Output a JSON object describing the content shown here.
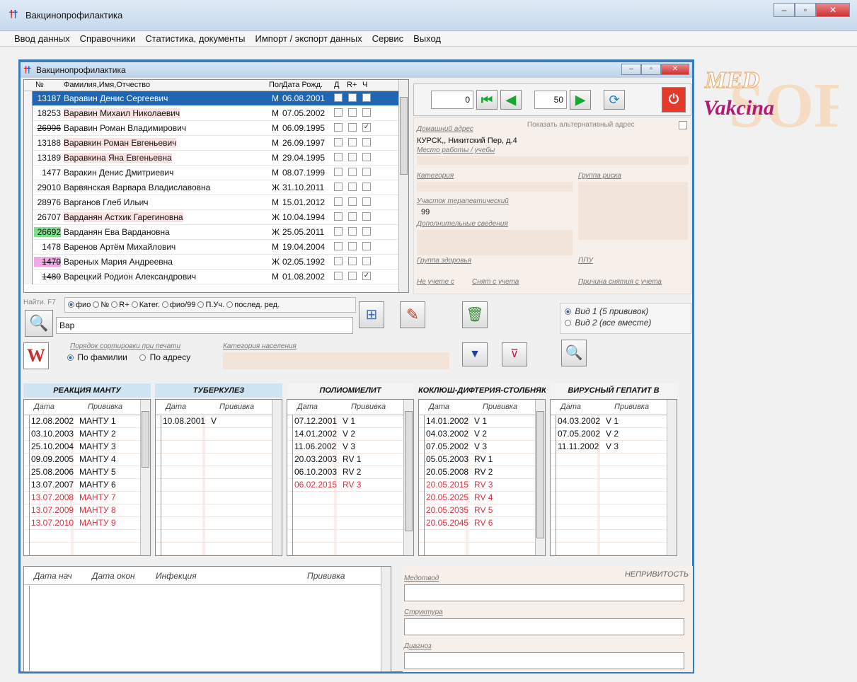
{
  "app": {
    "title": "Вакцинопрофилактика",
    "child_title": "Вакцинопрофилактика",
    "logo_top": "MED",
    "logo_bottom": "Vakcina",
    "logo_bg": "SOFT"
  },
  "menu": [
    "Ввод данных",
    "Справочники",
    "Статистика, документы",
    "Импорт / экспорт данных",
    "Сервис",
    "Выход"
  ],
  "grid": {
    "headers": {
      "num": "№",
      "fio": "Фамилия,Имя,Отчество",
      "sex": "Пол",
      "dob": "Дата Рожд.",
      "d": "Д",
      "r": "R+",
      "ch": "Ч"
    },
    "rows": [
      {
        "num": "13187",
        "fio": "Варавин Денис Сергеевич",
        "sex": "М",
        "dob": "06.08.2001",
        "checked": false
      },
      {
        "num": "18253",
        "fio": "Варавин Михаил Николаевич",
        "sex": "М",
        "dob": "07.05.2002",
        "checked": false
      },
      {
        "num": "26996",
        "fio": "Варавин Роман Владимирович",
        "sex": "М",
        "dob": "06.09.1995",
        "checked": true
      },
      {
        "num": "13188",
        "fio": "Варавкин Роман Евгеньевич",
        "sex": "М",
        "dob": "26.09.1997",
        "checked": false
      },
      {
        "num": "13189",
        "fio": "Варавкина Яна Евгеньевна",
        "sex": "М",
        "dob": "29.04.1995",
        "checked": false
      },
      {
        "num": "1477",
        "fio": "Варакин Денис Дмитриевич",
        "sex": "М",
        "dob": "08.07.1999",
        "checked": false
      },
      {
        "num": "29010",
        "fio": "Варвянская Варвара Владиславовна",
        "sex": "Ж",
        "dob": "31.10.2011",
        "checked": false
      },
      {
        "num": "28976",
        "fio": "Варганов Глеб Ильич",
        "sex": "М",
        "dob": "15.01.2012",
        "checked": false
      },
      {
        "num": "26707",
        "fio": "Варданян Астхик Гарегиновна",
        "sex": "Ж",
        "dob": "10.04.1994",
        "checked": false
      },
      {
        "num": "26692",
        "fio": "Варданян Ева Вардановна",
        "sex": "Ж",
        "dob": "25.05.2011",
        "checked": false
      },
      {
        "num": "1478",
        "fio": "Варенов Артём Михайлович",
        "sex": "М",
        "dob": "19.04.2004",
        "checked": false
      },
      {
        "num": "1479",
        "fio": "Вареных Мария Андреевна",
        "sex": "Ж",
        "dob": "02.05.1992",
        "checked": false
      },
      {
        "num": "1480",
        "fio": "Варецкий Родион Александрович",
        "sex": "М",
        "dob": "01.08.2002",
        "checked": true
      }
    ]
  },
  "nav": {
    "from": "0",
    "to": "50"
  },
  "detail": {
    "home_address_label": "Домашний адрес",
    "alt_address_label": "Показать альтернативный адрес",
    "address": "КУРСК,, Никитский Пер, д.4",
    "work_label": "Место работы / учебы",
    "category_label": "Категория",
    "risk_group_label": "Группа риска",
    "district_label": "Участок терапевтический",
    "district": "99",
    "extra_label": "Дополнительные сведения",
    "health_group_label": "Группа здоровья",
    "ppu_label": "ППУ",
    "not_registered_label": "Не учете с",
    "removed_label": "Снят с учета",
    "reason_label": "Причина снятия с учета"
  },
  "search": {
    "find_label": "Найти. F7",
    "options": [
      "фио",
      "№",
      "R+",
      "Катег.",
      "фио/99",
      "П.Уч.",
      "послед. ред."
    ],
    "value": "Вар",
    "view1": "Вид 1 (5 прививок)",
    "view2": "Вид 2 (все вместе)",
    "sort_label": "Порядок сортировки при печати",
    "sort_name": "По фамилии",
    "sort_addr": "По адресу",
    "category_label": "Категория населения"
  },
  "vacc_headers": [
    "РЕАКЦИЯ МАНТУ",
    "ТУБЕРКУЛЕЗ",
    "ПОЛИОМИЕЛИТ",
    "КОКЛЮШ-ДИФТЕРИЯ-СТОЛБНЯК",
    "ВИРУСНЫЙ ГЕПАТИТ В"
  ],
  "vacc_col": {
    "date": "Дата",
    "vac": "Прививка"
  },
  "vacc": [
    [
      {
        "d": "12.08.2002",
        "v": "МАНТУ 1",
        "red": false
      },
      {
        "d": "03.10.2003",
        "v": "МАНТУ 2",
        "red": false
      },
      {
        "d": "25.10.2004",
        "v": "МАНТУ 3",
        "red": false
      },
      {
        "d": "09.09.2005",
        "v": "МАНТУ 4",
        "red": false
      },
      {
        "d": "25.08.2006",
        "v": "МАНТУ 5",
        "red": false
      },
      {
        "d": "13.07.2007",
        "v": "МАНТУ 6",
        "red": false
      },
      {
        "d": "13.07.2008",
        "v": "МАНТУ 7",
        "red": true
      },
      {
        "d": "13.07.2009",
        "v": "МАНТУ 8",
        "red": true
      },
      {
        "d": "13.07.2010",
        "v": "МАНТУ 9",
        "red": true
      }
    ],
    [
      {
        "d": "10.08.2001",
        "v": "V",
        "red": false
      }
    ],
    [
      {
        "d": "07.12.2001",
        "v": "V 1",
        "red": false
      },
      {
        "d": "14.01.2002",
        "v": "V 2",
        "red": false
      },
      {
        "d": "11.06.2002",
        "v": "V 3",
        "red": false
      },
      {
        "d": "20.03.2003",
        "v": "RV 1",
        "red": false
      },
      {
        "d": "06.10.2003",
        "v": "RV 2",
        "red": false
      },
      {
        "d": "06.02.2015",
        "v": "RV 3",
        "red": true
      }
    ],
    [
      {
        "d": "14.01.2002",
        "v": "V 1",
        "red": false
      },
      {
        "d": "04.03.2002",
        "v": "V 2",
        "red": false
      },
      {
        "d": "07.05.2002",
        "v": "V 3",
        "red": false
      },
      {
        "d": "05.05.2003",
        "v": "RV 1",
        "red": false
      },
      {
        "d": "20.05.2008",
        "v": "RV 2",
        "red": false
      },
      {
        "d": "20.05.2015",
        "v": "RV 3",
        "red": true
      },
      {
        "d": "20.05.2025",
        "v": "RV 4",
        "red": true
      },
      {
        "d": "20.05.2035",
        "v": "RV 5",
        "red": true
      },
      {
        "d": "20.05.2045",
        "v": "RV 6",
        "red": true
      }
    ],
    [
      {
        "d": "04.03.2002",
        "v": "V 1",
        "red": false
      },
      {
        "d": "07.05.2002",
        "v": "V 2",
        "red": false
      },
      {
        "d": "11.11.2002",
        "v": "V 3",
        "red": false
      }
    ]
  ],
  "bottom": {
    "cols": [
      "Дата нач",
      "Дата окон",
      "Инфекция",
      "Прививка"
    ],
    "nonvacc": "НЕПРИВИТОСТЬ",
    "medotvod": "Медотвод",
    "struct": "Структура",
    "diag": "Диагноз"
  }
}
